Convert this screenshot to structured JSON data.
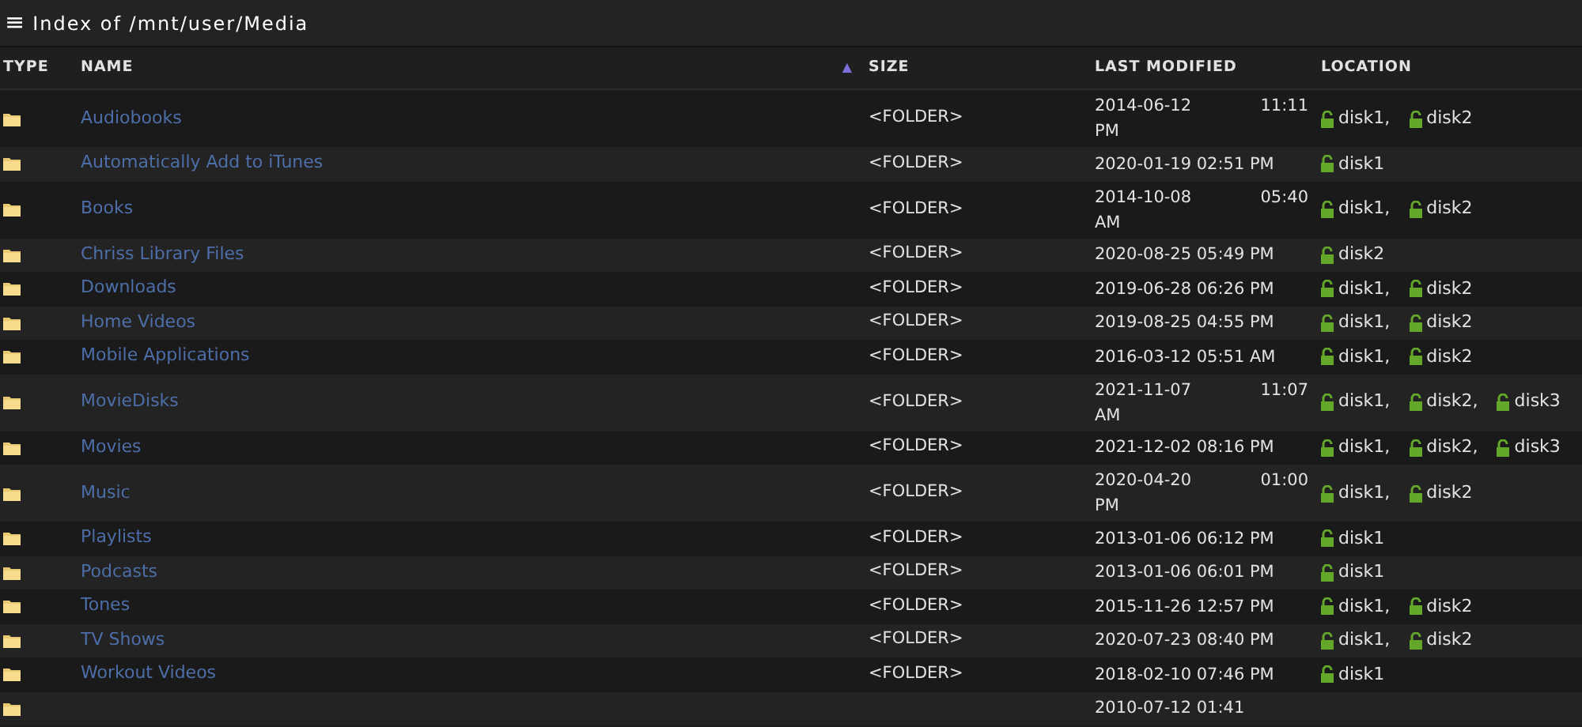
{
  "title": {
    "icon": "≡",
    "text": "Index of /mnt/user/Media"
  },
  "columns": [
    {
      "label": "TYPE",
      "sorted": false
    },
    {
      "label": "NAME",
      "sorted": true,
      "sort_icon": "▲"
    },
    {
      "label": "SIZE",
      "sorted": false
    },
    {
      "label": "LAST MODIFIED",
      "sorted": false
    },
    {
      "label": "LOCATION",
      "sorted": false
    }
  ],
  "rows": [
    {
      "name": "Audiobooks",
      "size": "<FOLDER>",
      "modified": [
        "2014-06-12 11:11",
        "PM"
      ],
      "location": [
        "disk1,",
        "disk2"
      ]
    },
    {
      "name": "Automatically Add to iTunes",
      "size": "<FOLDER>",
      "modified": [
        "2020-01-19 02:51 PM"
      ],
      "location": [
        "disk1"
      ]
    },
    {
      "name": "Books",
      "size": "<FOLDER>",
      "modified": [
        "2014-10-08 05:40",
        "AM"
      ],
      "location": [
        "disk1,",
        "disk2"
      ]
    },
    {
      "name": "Chriss Library Files",
      "size": "<FOLDER>",
      "modified": [
        "2020-08-25 05:49 PM"
      ],
      "location": [
        "disk2"
      ]
    },
    {
      "name": "Downloads",
      "size": "<FOLDER>",
      "modified": [
        "2019-06-28 06:26 PM"
      ],
      "location": [
        "disk1,",
        "disk2"
      ]
    },
    {
      "name": "Home Videos",
      "size": "<FOLDER>",
      "modified": [
        "2019-08-25 04:55 PM"
      ],
      "location": [
        "disk1,",
        "disk2"
      ]
    },
    {
      "name": "Mobile Applications",
      "size": "<FOLDER>",
      "modified": [
        "2016-03-12 05:51 AM"
      ],
      "location": [
        "disk1,",
        "disk2"
      ]
    },
    {
      "name": "MovieDisks",
      "size": "<FOLDER>",
      "modified": [
        "2021-11-07 11:07",
        "AM"
      ],
      "location": [
        "disk1,",
        "disk2,",
        "disk3"
      ]
    },
    {
      "name": "Movies",
      "size": "<FOLDER>",
      "modified": [
        "2021-12-02 08:16 PM"
      ],
      "location": [
        "disk1,",
        "disk2,",
        "disk3"
      ]
    },
    {
      "name": "Music",
      "size": "<FOLDER>",
      "modified": [
        "2020-04-20 01:00",
        "PM"
      ],
      "location": [
        "disk1,",
        "disk2"
      ]
    },
    {
      "name": "Playlists",
      "size": "<FOLDER>",
      "modified": [
        "2013-01-06 06:12 PM"
      ],
      "location": [
        "disk1"
      ]
    },
    {
      "name": "Podcasts",
      "size": "<FOLDER>",
      "modified": [
        "2013-01-06 06:01 PM"
      ],
      "location": [
        "disk1"
      ]
    },
    {
      "name": "Tones",
      "size": "<FOLDER>",
      "modified": [
        "2015-11-26 12:57 PM"
      ],
      "location": [
        "disk1,",
        "disk2"
      ]
    },
    {
      "name": "TV Shows",
      "size": "<FOLDER>",
      "modified": [
        "2020-07-23 08:40 PM"
      ],
      "location": [
        "disk1,",
        "disk2"
      ]
    },
    {
      "name": "Workout Videos",
      "size": "<FOLDER>",
      "modified": [
        "2018-02-10 07:46 PM"
      ],
      "location": [
        "disk1"
      ]
    },
    {
      "modified": [
        "2010-07-12 01:41"
      ]
    }
  ]
}
